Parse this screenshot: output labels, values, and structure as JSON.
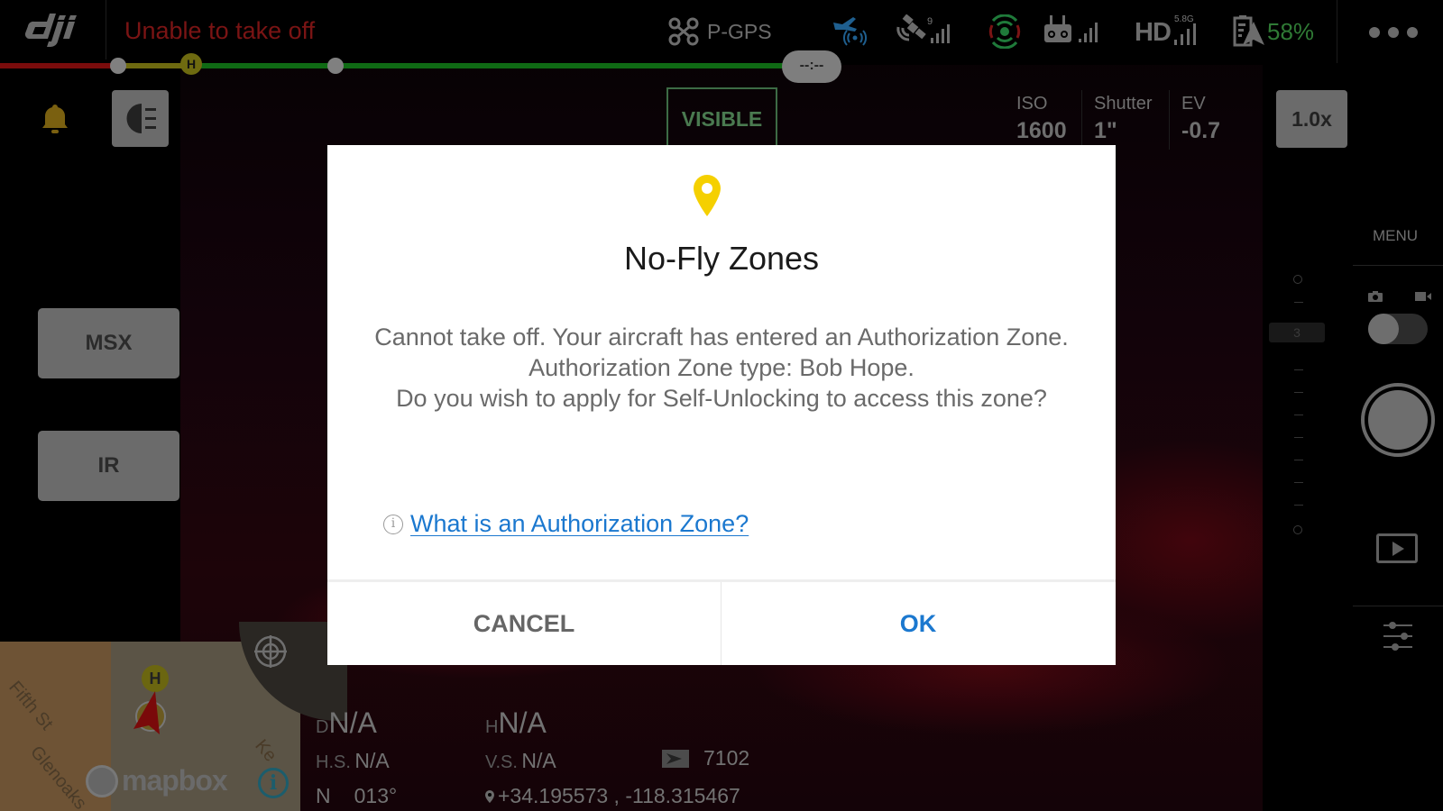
{
  "top_bar": {
    "logo": "dji",
    "status_message": "Unable to take off",
    "flight_mode": "P-GPS",
    "gps_satellite_count": "9",
    "hd_link_frequency": "5.8G",
    "hd_link_label": "HD",
    "battery_percent": "58%",
    "icons": [
      "aircraft-icon",
      "takeoff-signal-icon",
      "satellite-icon",
      "obstacle-sensing-icon",
      "remote-controller-icon",
      "hd-signal-icon",
      "battery-icon",
      "more-icon"
    ],
    "colors": {
      "status_error": "#7a1414",
      "battery_ok": "#2f7a35",
      "signal_blue": "#1f5f8f"
    }
  },
  "progress_line": {
    "home_marker_label": "H",
    "countdown": "--:--",
    "colors": {
      "red": "#7a0c0c",
      "yellow": "#6e6a10",
      "green": "#0f6a14"
    }
  },
  "left_controls": {
    "buttons": [
      {
        "label": "MSX"
      },
      {
        "label": "IR"
      }
    ]
  },
  "camera_settings": {
    "lens_mode": "VISIBLE",
    "iso_label": "ISO",
    "iso_value": "1600",
    "shutter_label": "Shutter",
    "shutter_value": "1\"",
    "ev_label": "EV",
    "ev_value": "-0.7",
    "zoom": "1.0x"
  },
  "right_panel": {
    "menu_label": "MENU",
    "ev_scale_value": "3",
    "capture_mode": "photo"
  },
  "map": {
    "streets": [
      "Fifth St",
      "Glenoaks",
      "Ke"
    ],
    "home_label": "H",
    "attribution": "mapbox"
  },
  "telemetry": {
    "distance_label": "D",
    "distance": "N/A",
    "height_label": "H",
    "height": "N/A",
    "hs_label": "H.S.",
    "hs": "N/A",
    "vs_label": "V.S.",
    "vs": "N/A",
    "heading_label": "N",
    "heading": "013°",
    "flight_distance_counter": "7102",
    "coordinates": "+34.195573 , -118.315467"
  },
  "dialog": {
    "title": "No-Fly Zones",
    "body_lines": [
      "Cannot take off. Your aircraft has entered an Authorization Zone.",
      "Authorization Zone type: Bob Hope.",
      "Do you wish to apply for Self-Unlocking to access this zone?"
    ],
    "info_link": "What is an Authorization Zone?",
    "cancel_label": "CANCEL",
    "ok_label": "OK",
    "colors": {
      "pin": "#f5d000",
      "link": "#1b78cf"
    }
  }
}
